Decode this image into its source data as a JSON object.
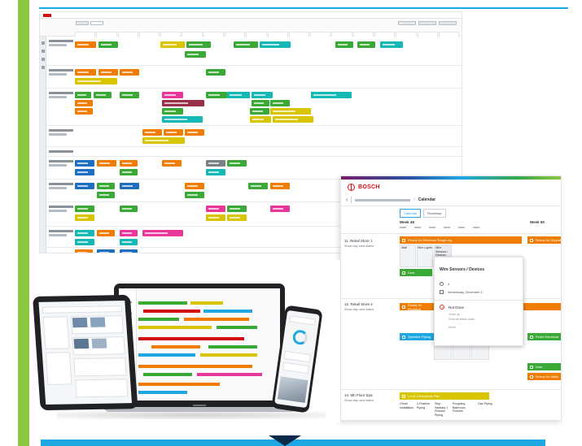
{
  "detail": {
    "brand": "BOSCH",
    "breadcrumb_current": "Calendar",
    "tabs": [
      "Calendar",
      "Roadmap"
    ],
    "week_left": "Week 49",
    "week_right": "Week 50",
    "rows": [
      {
        "label": "11. Retail Store 1",
        "sublabel": "Show day card status"
      },
      {
        "label": "12. Retail Store 2",
        "sublabel": "Show day card status"
      },
      {
        "label": "14. 5th Floor Spa",
        "sublabel": "Show day card status"
      }
    ],
    "bars": {
      "row1_main": "Ready for Electrical Rough-ing",
      "row1_right": "Ready for Drywall",
      "row1_dust": "Dust",
      "row2_main": "Ready for Electrical",
      "row2_sprinkler": "Sprinkler Piping",
      "row2_right": "Finish Electrical",
      "row2_dust": "Dust",
      "row2_ready": "Ready for Walls",
      "row3_main": "Level 3 Electrical Plan"
    },
    "card_titles": {
      "wall": "Wall",
      "wire_lights": "Wire Lights",
      "wire_sensors": "Wire Sensors / Devices",
      "row3_c1": "Ghost Installation",
      "row3_c2": "2-Position Piping",
      "row3_c3": "Stop Sanitary 1 Pictures Piping",
      "row3_c4": "Roughing Bathroom Fixtures",
      "row3_c5": "Gas Piping"
    },
    "popup": {
      "title": "Wire Sensors / Devices",
      "assignee_count": "4",
      "date": "Wednesday, December 3",
      "status": "Not Done",
      "status_action": "Touch up",
      "status_note": "Show all status notes",
      "link": "Reset"
    },
    "numbers": [
      "1",
      "2",
      "3"
    ]
  },
  "colors": {
    "orange": "#f07d00",
    "green": "#3aa935",
    "teal": "#16b8b5",
    "cyan": "#1ea7e1",
    "blue": "#1f6fc1",
    "yellow": "#d8c500",
    "magenta": "#e8379a",
    "maroon": "#9a2f4a",
    "gray": "#7b8085",
    "accent_green": "#8dc63f",
    "accent_blue": "#1ea7e1",
    "bosch_red": "#d40f14"
  }
}
